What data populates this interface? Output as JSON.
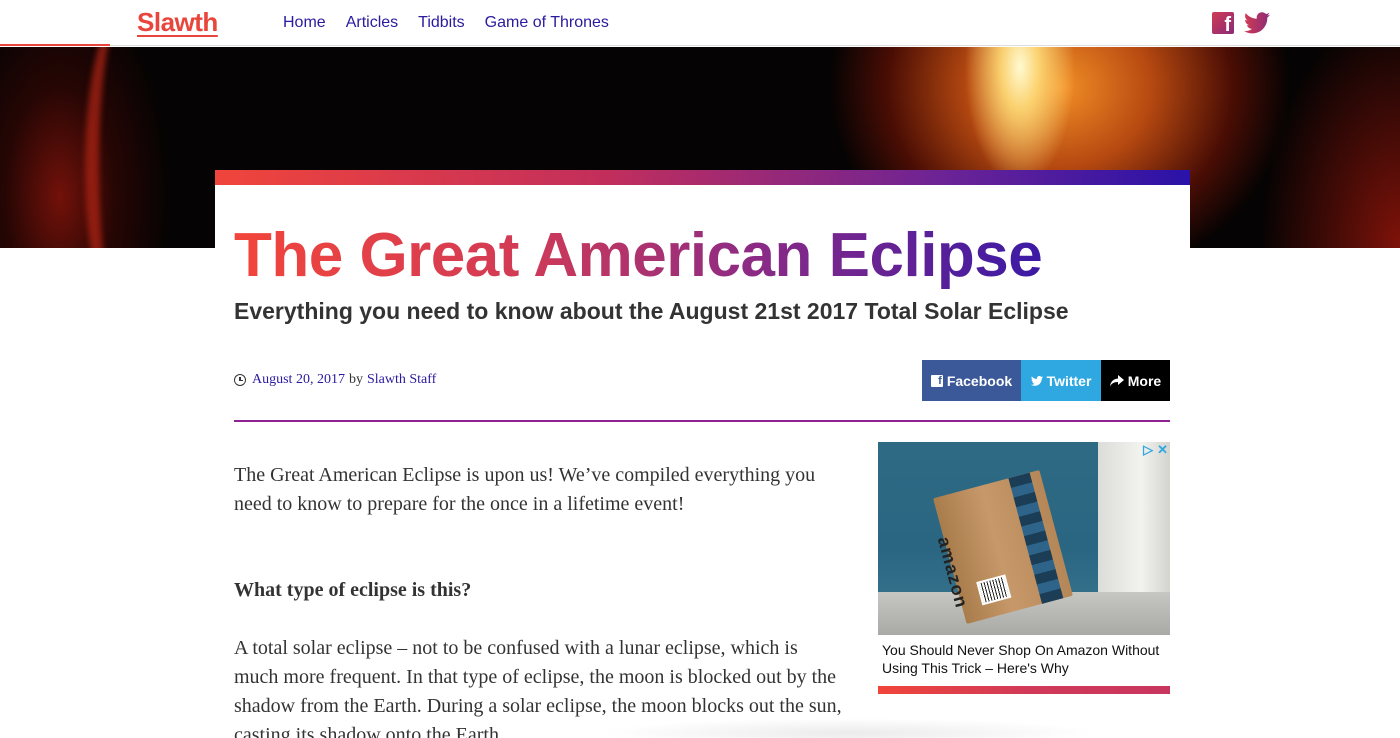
{
  "site": {
    "logo": "Slawth",
    "nav": [
      "Home",
      "Articles",
      "Tidbits",
      "Game of Thrones"
    ]
  },
  "article": {
    "title": "The Great American Eclipse",
    "subtitle": "Everything you need to know about the August 21st 2017 Total Solar Eclipse",
    "date": "August 20, 2017",
    "by": "by",
    "author": "Slawth Staff",
    "intro": "The Great American Eclipse is upon us! We’ve compiled everything you need to know to prepare for the once in a lifetime event!",
    "heading": "What type of eclipse is this?",
    "paragraph": "A total solar eclipse – not to be confused with a lunar eclipse, which is much more frequent. In that type of eclipse, the moon is blocked out by the shadow from the Earth. During a solar eclipse, the moon blocks out the sun, casting its shadow onto the Earth."
  },
  "share": {
    "facebook": "Facebook",
    "twitter": "Twitter",
    "more": "More"
  },
  "ad": {
    "brand": "amazon",
    "caption": "You Should Never Shop On Amazon Without Using This Trick – Here's Why"
  },
  "colors": {
    "brand_red": "#e8453c",
    "nav_link": "#2a1aa0",
    "facebook": "#3b5998",
    "twitter": "#2fa8e2",
    "divider": "#8e2290"
  }
}
